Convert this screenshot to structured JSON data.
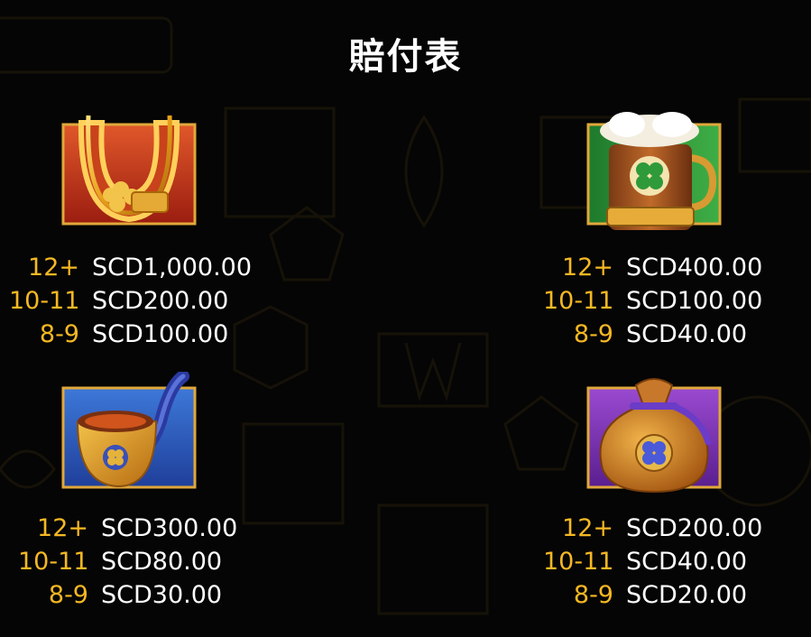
{
  "title": "賠付表",
  "colors": {
    "background": "#050505",
    "count_color": "#f5b823",
    "amount_color": "#ffffff"
  },
  "symbols": [
    {
      "icon": "horseshoe-icon",
      "pays": [
        {
          "count": "12+",
          "amount": "SCD1,000.00"
        },
        {
          "count": "10-11",
          "amount": "SCD200.00"
        },
        {
          "count": "8-9",
          "amount": "SCD100.00"
        }
      ]
    },
    {
      "icon": "beer-mug-icon",
      "pays": [
        {
          "count": "12+",
          "amount": "SCD400.00"
        },
        {
          "count": "10-11",
          "amount": "SCD100.00"
        },
        {
          "count": "8-9",
          "amount": "SCD40.00"
        }
      ]
    },
    {
      "icon": "pipe-icon",
      "pays": [
        {
          "count": "12+",
          "amount": "SCD300.00"
        },
        {
          "count": "10-11",
          "amount": "SCD80.00"
        },
        {
          "count": "8-9",
          "amount": "SCD30.00"
        }
      ]
    },
    {
      "icon": "money-bag-icon",
      "pays": [
        {
          "count": "12+",
          "amount": "SCD200.00"
        },
        {
          "count": "10-11",
          "amount": "SCD40.00"
        },
        {
          "count": "8-9",
          "amount": "SCD20.00"
        }
      ]
    }
  ]
}
